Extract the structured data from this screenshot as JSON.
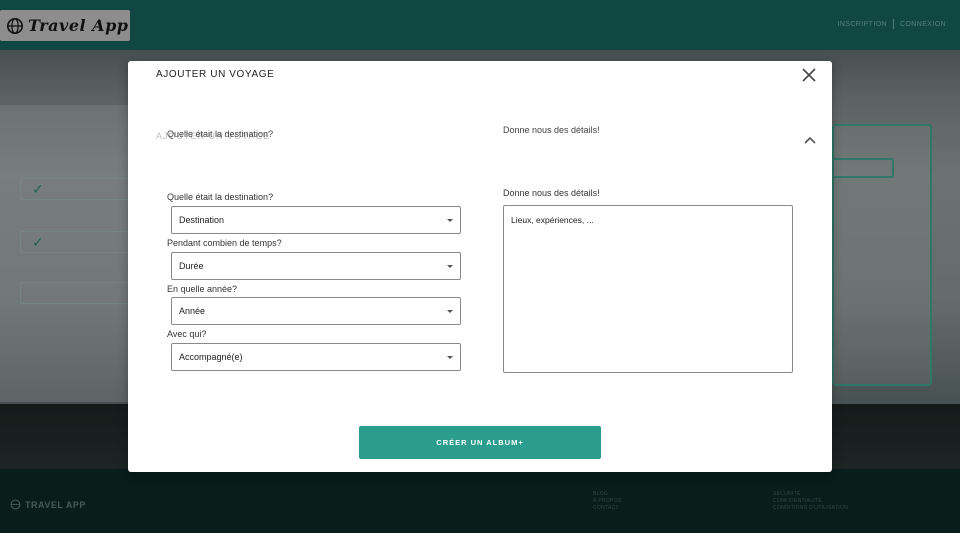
{
  "app": {
    "logo_text": "Travel App",
    "nav": [
      "INSCRIPTION",
      "CONNEXION"
    ]
  },
  "footer": {
    "logo_text": "TRAVEL APP",
    "col1": [
      "BLOG",
      "À PROPOS",
      "CONTACT"
    ],
    "col2": [
      "SÉCURITÉ",
      "CONFIDENTIALITÉ",
      "CONDITIONS D'UTILISATION"
    ]
  },
  "modal": {
    "title": "AJOUTER UN VOYAGE",
    "accordion_title": "AJOUTER UN VOYAGE",
    "ghost_question": "Quelle était la destination?",
    "ghost_details": "Donne nous des détails!",
    "fields": [
      {
        "label": "Quelle était la destination?",
        "value": "Destination"
      },
      {
        "label": "Pendant combien de temps?",
        "value": "Durée"
      },
      {
        "label": "En quelle année?",
        "value": "Année"
      },
      {
        "label": "Avec qui?",
        "value": "Accompagné(e)"
      }
    ],
    "details_label": "Donne nous des détails!",
    "details_placeholder": "Lieux, expériences, ...",
    "create_button": "CRÉER UN ALBUM+"
  },
  "colors": {
    "primary": "#2a9d8f",
    "header": "#1b6e66",
    "footer": "#0e2d2a"
  }
}
